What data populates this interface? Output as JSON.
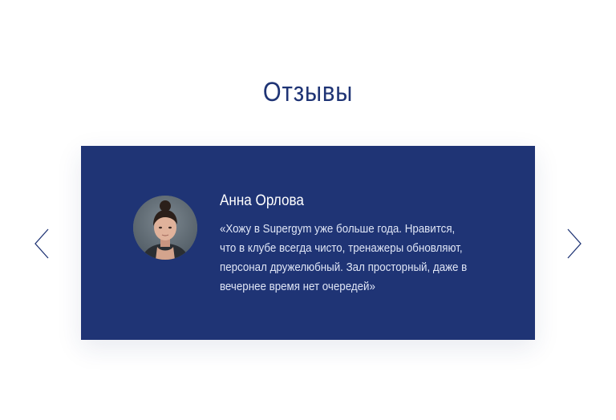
{
  "section": {
    "title": "Отзывы"
  },
  "colors": {
    "brand": "#1f3475",
    "card_background": "#1f3475",
    "title": "#1f3475",
    "card_text": "#ffffff"
  },
  "slider": {
    "prev_icon": "chevron-left-icon",
    "next_icon": "chevron-right-icon"
  },
  "review": {
    "author": "Анна Орлова",
    "avatar_icon": "avatar-photo",
    "text_lines": [
      "«Хожу в Supergym уже больше года. Нравится,",
      "что в клубе всегда чисто, тренажеры обновляют,",
      "персонал дружелюбный. Зал просторный, даже в",
      "вечернее время нет очередей»"
    ]
  }
}
